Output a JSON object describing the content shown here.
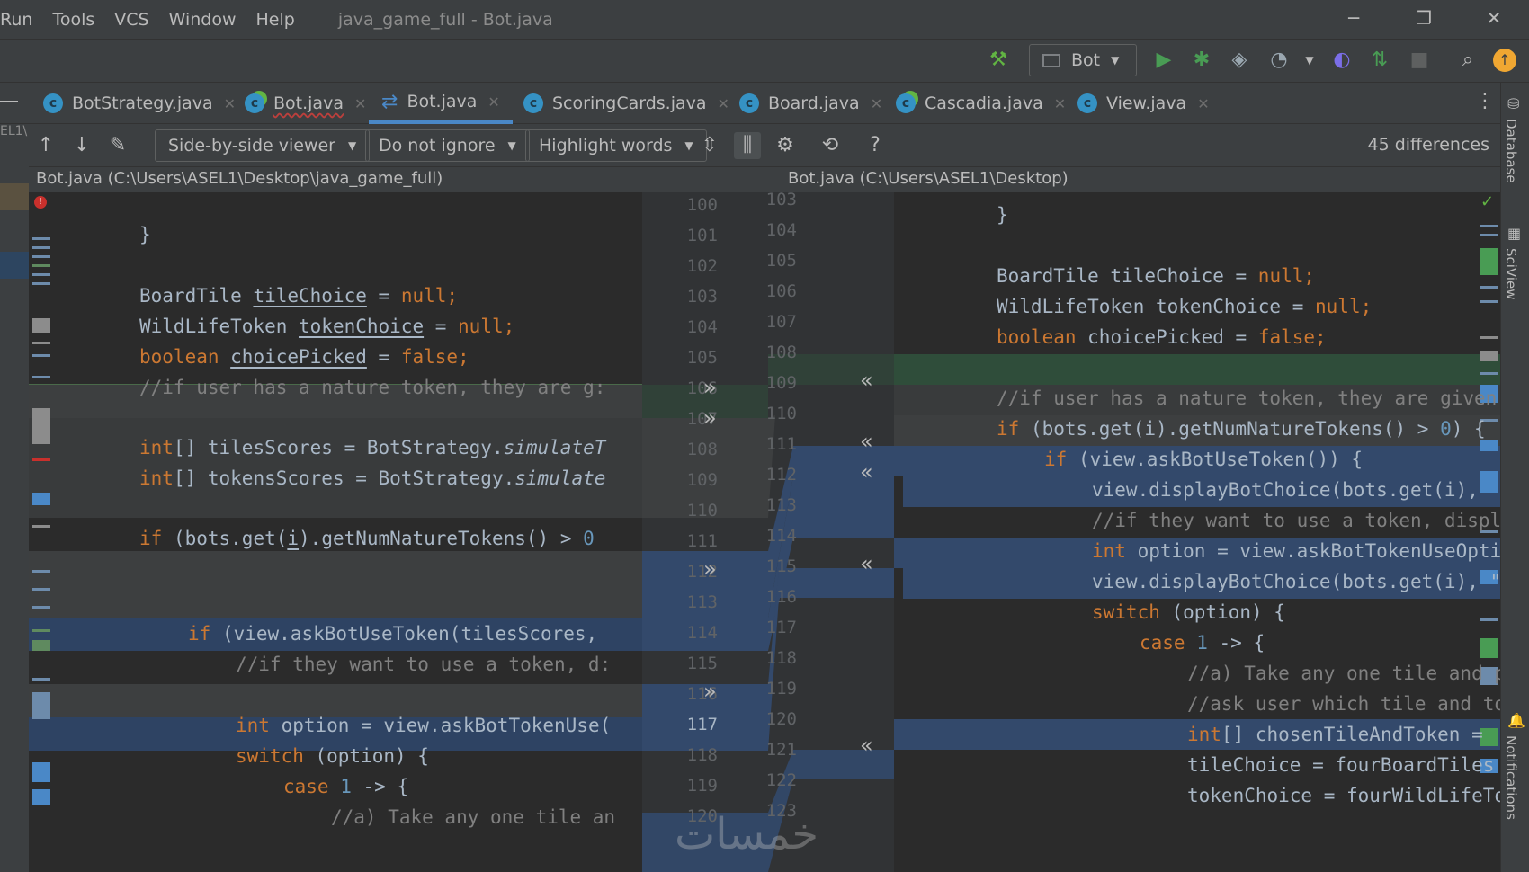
{
  "menubar": {
    "items": [
      "Run",
      "Tools",
      "VCS",
      "Window",
      "Help"
    ],
    "title": "java_game_full - Bot.java"
  },
  "window_controls": {
    "minimize": "─",
    "restore": "❐",
    "close": "✕"
  },
  "toolbar": {
    "run_config": "Bot"
  },
  "tabs": [
    {
      "label": "BotStrategy.java"
    },
    {
      "label": "Bot.java"
    },
    {
      "label": "Bot.java"
    },
    {
      "label": "ScoringCards.java"
    },
    {
      "label": "Board.java"
    },
    {
      "label": "Cascadia.java"
    },
    {
      "label": "View.java"
    }
  ],
  "right_strip": {
    "database": "Database",
    "sciview": "SciView",
    "notifications": "Notifications"
  },
  "left_strip": {
    "label": "EL1\\"
  },
  "diff_toolbar": {
    "viewer": "Side-by-side viewer",
    "ignore": "Do not ignore",
    "highlight": "Highlight words",
    "differences": "45 differences",
    "help": "?"
  },
  "paths": {
    "left": "Bot.java (C:\\Users\\ASEL1\\Desktop\\java_game_full)",
    "right": "Bot.java (C:\\Users\\ASEL1\\Desktop)"
  },
  "left_line_numbers": [
    "100",
    "101",
    "102",
    "103",
    "104",
    "105",
    "106",
    "107",
    "108",
    "109",
    "110",
    "111",
    "112",
    "113",
    "114",
    "115",
    "116",
    "117",
    "118",
    "119",
    "120"
  ],
  "right_line_numbers": [
    "103",
    "104",
    "105",
    "106",
    "107",
    "108",
    "109",
    "110",
    "111",
    "112",
    "113",
    "114",
    "115",
    "116",
    "117",
    "118",
    "119",
    "120",
    "121",
    "122",
    "123"
  ],
  "left_code": {
    "l101": "}",
    "l103a": "BoardTile ",
    "l103b": "tileChoice",
    "l103c": " = ",
    "l103d": "null",
    "l103e": ";",
    "l104a": "WildLifeToken ",
    "l104b": "tokenChoice",
    "l104c": " = ",
    "l104d": "null",
    "l104e": ";",
    "l105a": "boolean ",
    "l105b": "choicePicked",
    "l105c": " = ",
    "l105d": "false",
    "l105e": ";",
    "l106": "//if user has a nature token, they are g:",
    "l108a": "int",
    "l108b": "[] tilesScores = BotStrategy.",
    "l108c": "simulateT",
    "l109a": "int",
    "l109b": "[] tokensScores = BotStrategy.",
    "l109c": "simulate",
    "l111a": "if",
    "l111b": " (bots.get(",
    "l111c": "i",
    "l111d": ").getNumNatureTokens() > ",
    "l111e": "0",
    "l114a": "if",
    "l114b": " (view.askBotUseToken(tilesScores,",
    "l115": "//if they want to use a token, d:",
    "l117a": "int",
    "l117b": " option = view.askBotTokenUse(",
    "l118a": "switch",
    "l118b": " (option) {",
    "l119a": "case ",
    "l119b": "1",
    "l119c": " -> {",
    "l120": "//a) Take any one tile an"
  },
  "right_code": {
    "r104": "}",
    "r106a": "BoardTile tileChoice = ",
    "r106b": "null",
    "r106c": ";",
    "r107a": "WildLifeToken tokenChoice = ",
    "r107b": "null",
    "r107c": ";",
    "r108a": "boolean ",
    "r108b": "choicePicked = ",
    "r108c": "false",
    "r108d": ";",
    "r110": "//if user has a nature token, they are given",
    "r111a": "if",
    "r111b": " (bots.get(i).getNumNatureTokens() > ",
    "r111c": "0",
    "r111d": ") {",
    "r112a": "if",
    "r112b": " (view.askBotUseToken()) {",
    "r113": "view.displayBotChoice(bots.get(i), ",
    "r114": "//if they want to use a token, displa",
    "r115a": "int",
    "r115b": " option = view.askBotTokenUseOptic",
    "r116": "view.displayBotChoice(bots.get(i), \"",
    "r117a": "switch",
    "r117b": " (option) {",
    "r118a": "case ",
    "r118b": "1",
    "r118c": " -> {",
    "r119": "//a) Take any one tile and p",
    "r120": "//ask user which tile and tok",
    "r121a": "int",
    "r121b": "[] chosenTileAndToken = ",
    "r122": "tileChoice = fourBoardTiles",
    "r123": "tokenChoice = fourWildLifeTo"
  },
  "watermark": "خمسات",
  "colors": {
    "background": "#2b2b2b",
    "panel": "#3c3f41",
    "keyword": "#cc7832",
    "number": "#6897bb",
    "comment": "#808080",
    "changed": "#33496b",
    "deleted": "#3d3f40",
    "inserted": "#2f4d3a",
    "accent": "#4a88c7"
  }
}
